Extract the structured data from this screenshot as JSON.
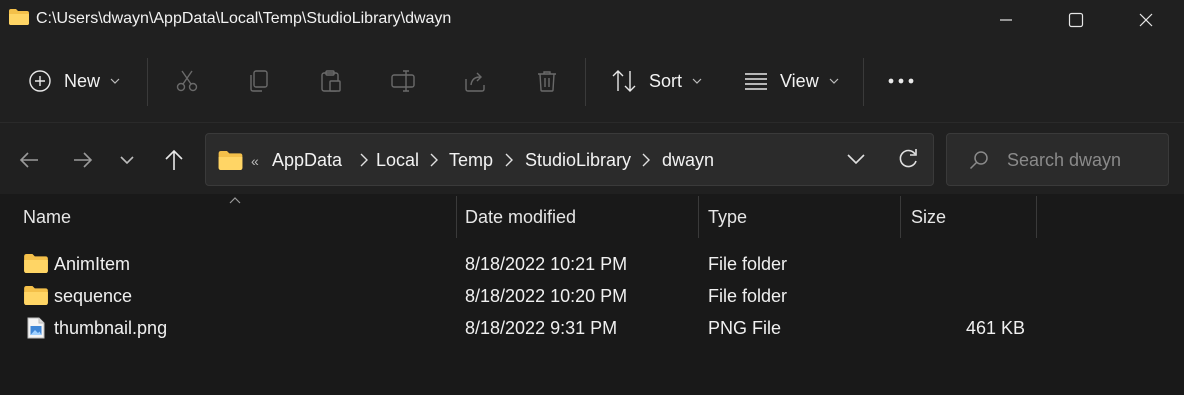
{
  "window": {
    "title": "C:\\Users\\dwayn\\AppData\\Local\\Temp\\StudioLibrary\\dwayn"
  },
  "toolbar": {
    "new_label": "New",
    "sort_label": "Sort",
    "view_label": "View"
  },
  "address": {
    "overflow": "«",
    "crumbs": [
      "AppData",
      "Local",
      "Temp",
      "StudioLibrary",
      "dwayn"
    ]
  },
  "search": {
    "placeholder": "Search dwayn"
  },
  "columns": {
    "name": "Name",
    "date": "Date modified",
    "type": "Type",
    "size": "Size"
  },
  "files": [
    {
      "name": "AnimItem",
      "date": "8/18/2022 10:21 PM",
      "type": "File folder",
      "size": "",
      "icon": "folder-icon"
    },
    {
      "name": "sequence",
      "date": "8/18/2022 10:20 PM",
      "type": "File folder",
      "size": "",
      "icon": "folder-icon"
    },
    {
      "name": "thumbnail.png",
      "date": "8/18/2022 9:31 PM",
      "type": "PNG File",
      "size": "461 KB",
      "icon": "image-file-icon"
    }
  ],
  "colors": {
    "background": "#191919",
    "chrome": "#202020",
    "folder": "#f4c04a",
    "accent": "#5aa0e6"
  }
}
